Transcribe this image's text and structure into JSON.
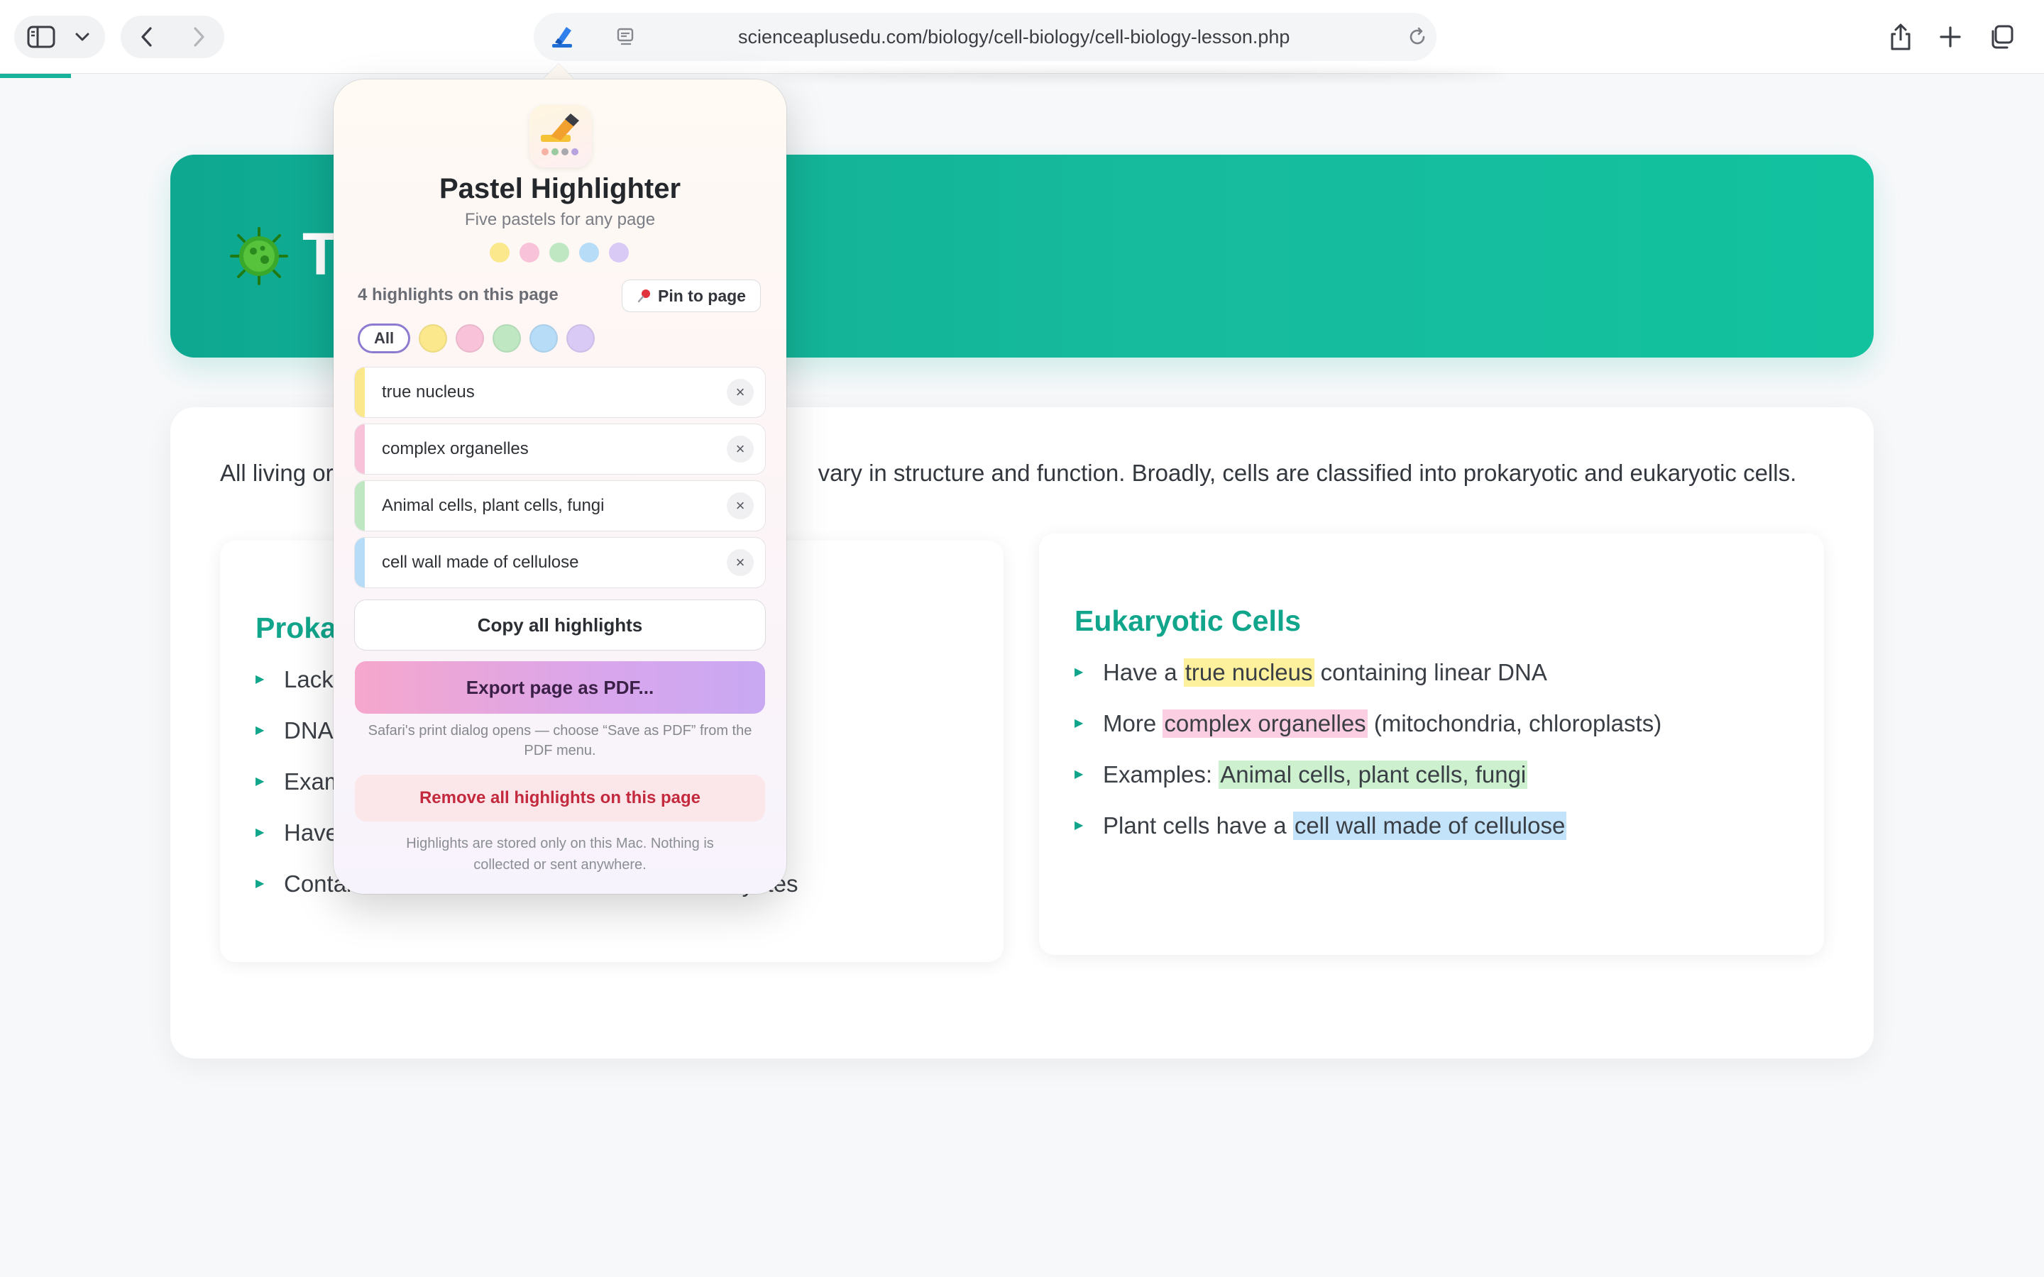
{
  "browser": {
    "url": "scienceaplusedu.com/biology/cell-biology/cell-biology-lesson.php",
    "accent_color": "#16b39a"
  },
  "page": {
    "hero_title": "T",
    "intro_left": "All living or",
    "intro_right": "vary in structure and function. Broadly, cells are classified into prokaryotic and eukaryotic cells.",
    "left_card": {
      "title": "Proka",
      "items": [
        "Lack",
        "DNA",
        "Exam",
        "Have",
        "Contain ribosomes but smaller than in eukaryotes"
      ]
    },
    "right_card": {
      "title": "Eukaryotic Cells",
      "items": [
        {
          "pre": "Have a ",
          "hl": "true nucleus",
          "post": " containing linear DNA",
          "color": "yellow"
        },
        {
          "pre": "More ",
          "hl": "complex organelles",
          "post": " (mitochondria, chloroplasts)",
          "color": "pink"
        },
        {
          "pre": "Examples: ",
          "hl": "Animal cells, plant cells, fungi",
          "post": "",
          "color": "green"
        },
        {
          "pre": "Plant cells have a ",
          "hl": "cell wall made of cellulose",
          "post": "",
          "color": "blue"
        }
      ]
    }
  },
  "popover": {
    "title": "Pastel Highlighter",
    "subtitle": "Five pastels for any page",
    "pastels": {
      "yellow": "#fbe88c",
      "pink": "#f8c3d8",
      "green": "#bfe8c2",
      "blue": "#b6dcf7",
      "purple": "#d9c9f5"
    },
    "count_label": "4 highlights on this page",
    "pin_label": "Pin to page",
    "filter_all_label": "All",
    "highlights": [
      {
        "text": "true nucleus",
        "color": "#fbe88c"
      },
      {
        "text": "complex organelles",
        "color": "#f8c3d8"
      },
      {
        "text": "Animal cells, plant cells, fungi",
        "color": "#bfe8c2"
      },
      {
        "text": "cell wall made of cellulose",
        "color": "#b6dcf7"
      }
    ],
    "remove_glyph": "×",
    "copy_label": "Copy all highlights",
    "export_label": "Export page as PDF...",
    "export_note": "Safari's print dialog opens — choose “Save as PDF” from the PDF menu.",
    "remove_all_label": "Remove all highlights on this page",
    "privacy_note": "Highlights are stored only on this Mac. Nothing is collected or sent anywhere."
  }
}
